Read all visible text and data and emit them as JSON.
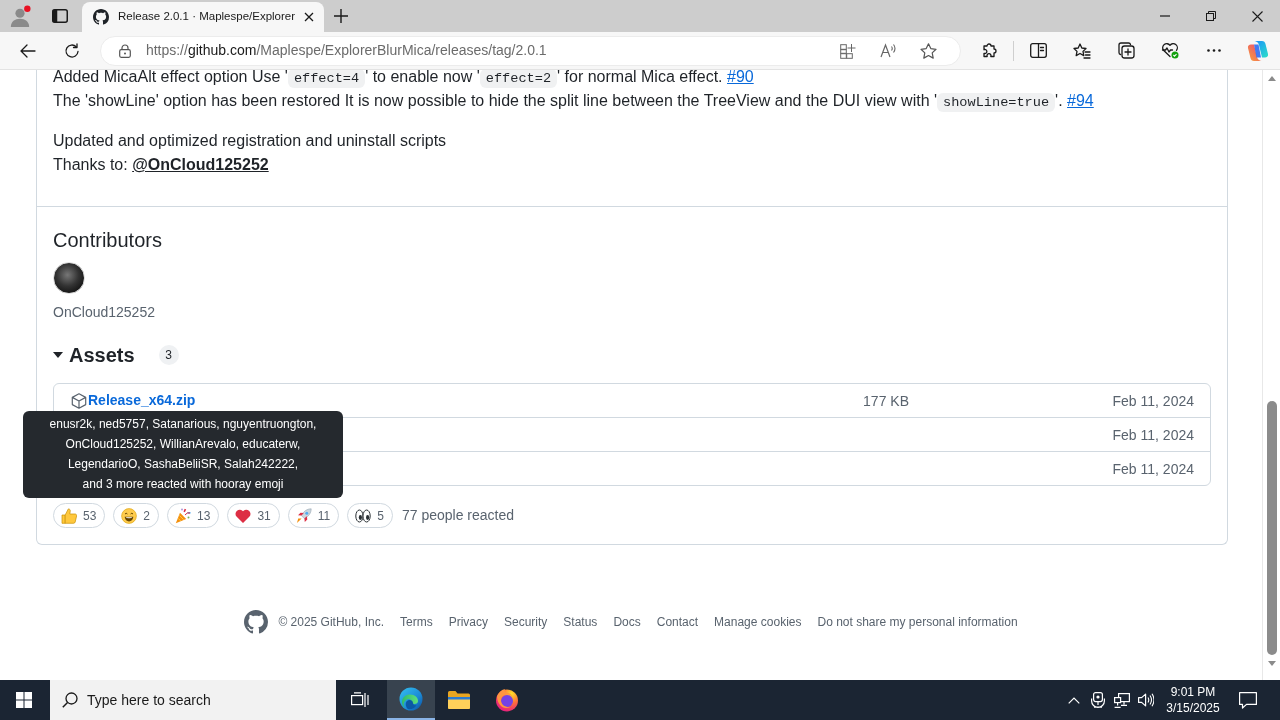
{
  "browser": {
    "tab_title": "Release 2.0.1 · Maplespe/Explorer",
    "url": {
      "scheme": "https://",
      "host": "github.com",
      "path": "/Maplespe/ExplorerBlurMica/releases/tag/2.0.1"
    }
  },
  "release_notes": [
    {
      "lines": [
        [
          {
            "kind": "text",
            "text": "Added MicaAlt effect option Use '"
          },
          {
            "kind": "code",
            "text": "effect=4"
          },
          {
            "kind": "text",
            "text": "' to enable now '"
          },
          {
            "kind": "code",
            "text": "effect=2"
          },
          {
            "kind": "text",
            "text": "' for normal Mica effect. "
          },
          {
            "kind": "link",
            "text": "#90"
          }
        ],
        [
          {
            "kind": "text",
            "text": "The 'showLine' option has been restored It is now possible to hide the split line between the TreeView and the DUI view with '"
          },
          {
            "kind": "code",
            "text": "showLine=true"
          },
          {
            "kind": "text",
            "text": "'. "
          },
          {
            "kind": "link",
            "text": "#94"
          }
        ]
      ]
    },
    {
      "lines": [
        [
          {
            "kind": "text",
            "text": "Updated and optimized registration and uninstall scripts"
          }
        ],
        [
          {
            "kind": "text",
            "text": "Thanks to: "
          },
          {
            "kind": "mention",
            "text": "@OnCloud125252"
          }
        ]
      ]
    }
  ],
  "contributors": {
    "heading": "Contributors",
    "people": [
      {
        "name": "OnCloud125252"
      }
    ]
  },
  "assets": {
    "heading": "Assets",
    "count": "3",
    "expanded": true,
    "files": [
      {
        "name": "Release_x64.zip",
        "size": "177 KB",
        "date": "Feb 11, 2024"
      },
      {
        "date": "Feb 11, 2024"
      },
      {
        "date": "Feb 11, 2024"
      }
    ]
  },
  "reactions": {
    "items": [
      {
        "kind": "thumbs_up",
        "count": "53"
      },
      {
        "kind": "laugh",
        "count": "2"
      },
      {
        "kind": "hooray",
        "count": "13"
      },
      {
        "kind": "heart",
        "count": "31"
      },
      {
        "kind": "rocket",
        "count": "11"
      },
      {
        "kind": "eyes",
        "count": "5"
      }
    ],
    "summary": "77 people reacted"
  },
  "tooltip": {
    "text": "enusr2k, ned5757, Satanarious, nguyentruongton,\nOnCloud125252, WillianArevalo, educaterw,\nLegendarioO, SashaBeliiSR, Salah242222,\nand 3 more reacted with hooray emoji"
  },
  "footer": {
    "copyright": "© 2025 GitHub, Inc.",
    "links": [
      "Terms",
      "Privacy",
      "Security",
      "Status",
      "Docs",
      "Contact",
      "Manage cookies",
      "Do not share my personal information"
    ]
  },
  "taskbar": {
    "search_placeholder": "Type here to search",
    "apps": [
      {
        "kind": "edge",
        "selected": true
      },
      {
        "kind": "explorer",
        "selected": false
      },
      {
        "kind": "firefox",
        "selected": false
      }
    ],
    "time": "9:01 PM",
    "date": "3/15/2025"
  }
}
